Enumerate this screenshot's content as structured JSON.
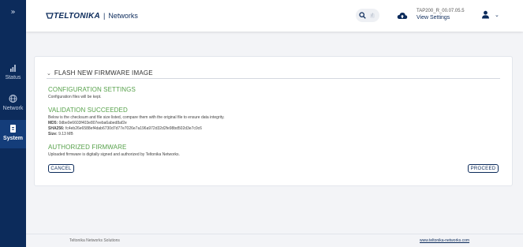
{
  "sidebar": {
    "expand_glyph": "»",
    "items": [
      {
        "label": "Status",
        "icon": "status-bars-icon"
      },
      {
        "label": "Network",
        "icon": "globe-icon"
      },
      {
        "label": "System",
        "icon": "system-icon",
        "active": true
      }
    ]
  },
  "header": {
    "brand": "TELTONIKA",
    "brand_separator": "|",
    "brand_suffix": "Networks",
    "search_shortcut": "/",
    "firmware_version": "TAP200_R_00.07.05.5",
    "view_settings_label": "View Settings"
  },
  "card": {
    "title": "FLASH NEW FIRMWARE IMAGE",
    "configuration": {
      "title": "CONFIGURATION SETTINGS",
      "text": "Configuration files will be kept."
    },
    "validation": {
      "title": "VALIDATION SUCCEEDED",
      "text": "Below is the checksum and file size listed, compare them with the original file to ensure data integrity.",
      "md5_label": "MD5:",
      "md5_value": "0dbe0e6603f403e807eeba6abed8af2e",
      "sha256_label": "SHA256:",
      "sha256_value": "fc4eb26e6588ef4dab6730d7d77e7026e7a196a972d32d2fe98bd502d3e7c0c6",
      "size_label": "Size:",
      "size_value": "9.13 MB"
    },
    "authorized": {
      "title": "AUTHORIZED FIRMWARE",
      "text": "Uploaded firmware is digitally signed and authorized by Teltonika Networks."
    },
    "cancel_label": "CANCEL",
    "proceed_label": "PROCEED"
  },
  "footer": {
    "company": "Teltonika Networks Solutions",
    "website": "www.teltonika-networks.com"
  },
  "colors": {
    "sidebar_bg": "#0c2b5b",
    "brand_navy": "#0c2b5b",
    "section_green": "#57a14b",
    "page_bg": "#f3f4f7"
  }
}
